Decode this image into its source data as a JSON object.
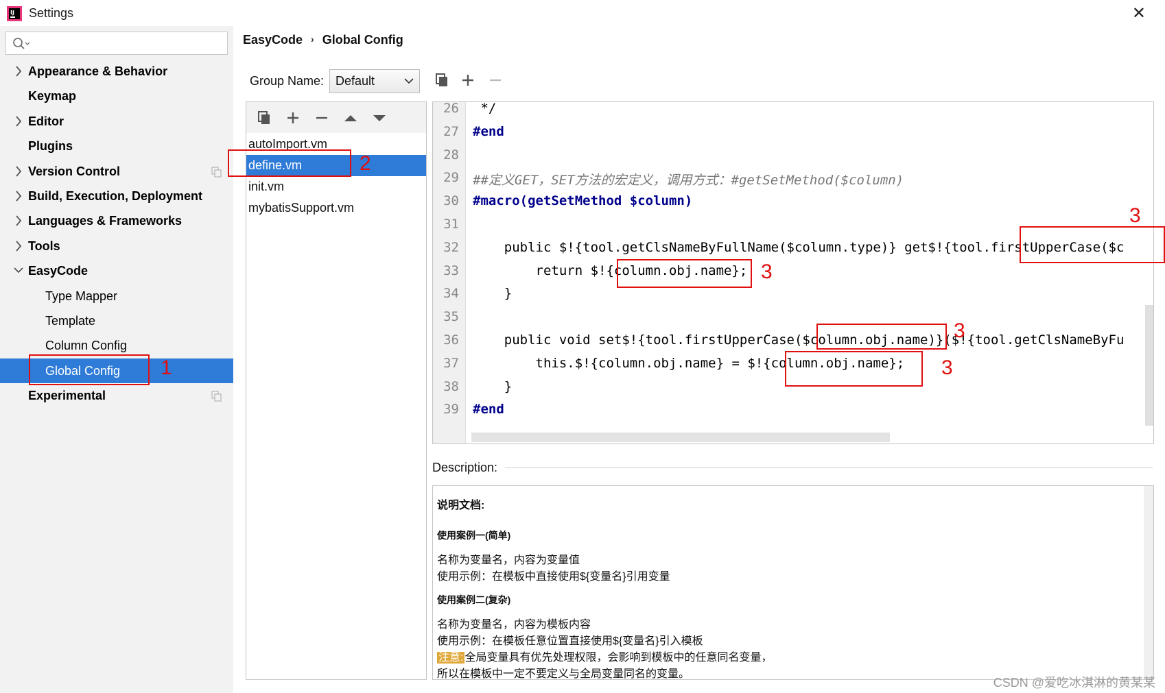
{
  "window": {
    "title": "Settings",
    "close_glyph": "✕"
  },
  "sidebar": {
    "search_placeholder": "",
    "items": [
      {
        "label": "Appearance & Behavior",
        "expandable": true,
        "bold": true
      },
      {
        "label": "Keymap",
        "expandable": false,
        "bold": true
      },
      {
        "label": "Editor",
        "expandable": true,
        "bold": true
      },
      {
        "label": "Plugins",
        "expandable": false,
        "bold": true
      },
      {
        "label": "Version Control",
        "expandable": true,
        "bold": true,
        "copy_icon": true
      },
      {
        "label": "Build, Execution, Deployment",
        "expandable": true,
        "bold": true
      },
      {
        "label": "Languages & Frameworks",
        "expandable": true,
        "bold": true
      },
      {
        "label": "Tools",
        "expandable": true,
        "bold": true
      },
      {
        "label": "EasyCode",
        "expandable": true,
        "expanded": true,
        "bold": true
      },
      {
        "label": "Type Mapper",
        "child": true
      },
      {
        "label": "Template",
        "child": true
      },
      {
        "label": "Column Config",
        "child": true
      },
      {
        "label": "Global Config",
        "child": true,
        "selected": true
      },
      {
        "label": "Experimental",
        "expandable": false,
        "bold": true,
        "copy_icon": true
      }
    ]
  },
  "breadcrumb": {
    "root": "EasyCode",
    "current": "Global Config"
  },
  "group": {
    "label": "Group Name:",
    "value": "Default"
  },
  "files": [
    "autoImport.vm",
    "define.vm",
    "init.vm",
    "mybatisSupport.vm"
  ],
  "editor": {
    "line_numbers": [
      "26",
      "27",
      "28",
      "29",
      "30",
      "31",
      "32",
      "33",
      "34",
      "35",
      "36",
      "37",
      "38",
      "39"
    ],
    "lines": [
      " */",
      "#end",
      "",
      "##定义GET，SET方法的宏定义，调用方式：#getSetMethod($column)",
      "#macro(getSetMethod $column)",
      "",
      "    public $!{tool.getClsNameByFullName($column.type)} get$!{tool.firstUpperCase($c",
      "        return $!{column.obj.name};",
      "    }",
      "",
      "    public void set$!{tool.firstUpperCase($column.obj.name)}($!{tool.getClsNameByFu",
      "        this.$!{column.obj.name} = $!{column.obj.name};",
      "    }",
      "#end"
    ]
  },
  "description": {
    "label": "Description:",
    "heading": "说明文档:",
    "case1_title": "使用案例一(简单)",
    "case1_line1": "名称为变量名，内容为变量值",
    "case1_line2": "使用示例：在模板中直接使用${变量名}引用变量",
    "case2_title": "使用案例二(复杂)",
    "case2_line1": "名称为变量名，内容为模板内容",
    "case2_line2": "使用示例：在模板任意位置直接使用${变量名}引入模板",
    "note_tag": "注意:",
    "note_line1": "全局变量具有优先处理权限，会影响到模板中的任意同名变量，",
    "note_line2": "所以在模板中一定不要定义与全局变量同名的变量。"
  },
  "annotations": [
    "1",
    "2",
    "3",
    "3",
    "3",
    "3"
  ],
  "watermark": "CSDN @爱吃冰淇淋的黄某某",
  "colors": {
    "selection": "#2f7bd8",
    "annotation": "#e01010",
    "keyword": "#00008b"
  }
}
